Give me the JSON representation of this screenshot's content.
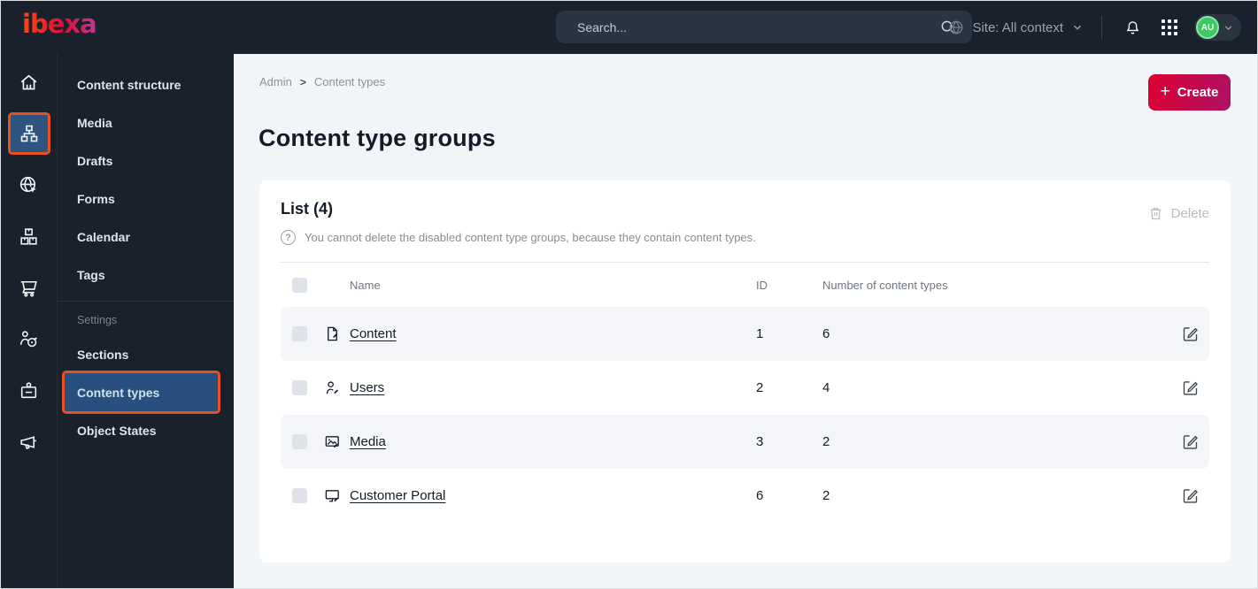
{
  "topbar": {
    "logo": "ibexa",
    "search": {
      "placeholder": "Search..."
    },
    "site_context": "Site: All context",
    "avatar_initials": "AU"
  },
  "nav_rail": {
    "icons": [
      "home-icon",
      "sitemap-icon",
      "globe-cursor-icon",
      "boxes-icon",
      "cart-icon",
      "person-target-icon",
      "id-card-icon",
      "megaphone-icon"
    ],
    "active_icon": "sitemap-icon"
  },
  "sidebar": {
    "items": [
      "Content structure",
      "Media",
      "Drafts",
      "Forms",
      "Calendar",
      "Tags"
    ],
    "settings_label": "Settings",
    "settings_items": [
      "Sections",
      "Content types",
      "Object States"
    ],
    "active_item": "Content types"
  },
  "main": {
    "breadcrumb": [
      "Admin",
      "Content types"
    ],
    "create_label": "Create",
    "title": "Content type groups",
    "card": {
      "list_title": "List (4)",
      "help_text": "You cannot delete the disabled content type groups, because they contain content types.",
      "delete_label": "Delete",
      "table": {
        "columns": [
          "Name",
          "ID",
          "Number of content types"
        ],
        "rows": [
          {
            "icon": "file-edit-icon",
            "name": "Content",
            "id": "1",
            "count": "6"
          },
          {
            "icon": "user-edit-icon",
            "name": "Users",
            "id": "2",
            "count": "4"
          },
          {
            "icon": "image-edit-icon",
            "name": "Media",
            "id": "3",
            "count": "2"
          },
          {
            "icon": "monitor-edit-icon",
            "name": "Customer Portal",
            "id": "6",
            "count": "2"
          }
        ]
      }
    }
  },
  "colors": {
    "topbar_bg": "#19222c",
    "active_blue": "#2e5480",
    "annotation_orange": "#e8501f",
    "create_gradient_start": "#db0032",
    "create_gradient_end": "#ae1164",
    "page_bg": "#f2f5f8",
    "row_stripe": "#f4f5f8",
    "avatar_green": "#3ec764"
  }
}
